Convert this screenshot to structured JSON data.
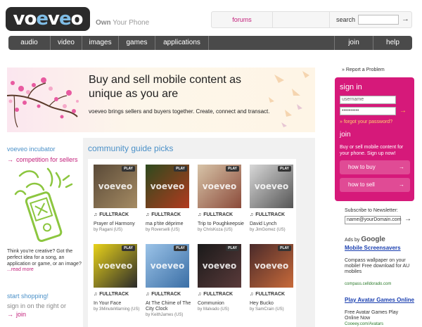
{
  "header": {
    "logo_text": "voeveo",
    "tagline_own": "Own",
    "tagline_rest": " Your Phone",
    "forums": "forums",
    "search_label": "search",
    "search_go": "→"
  },
  "nav": {
    "items": [
      "audio",
      "video",
      "images",
      "games",
      "applications"
    ],
    "join": "join",
    "help": "help"
  },
  "hero": {
    "headline": "Buy and sell mobile content as unique as you are",
    "body": "voeveo brings sellers and buyers together. Create, connect and transact."
  },
  "left": {
    "incubator_title": "voeveo incubator",
    "incubator_link": "competition for sellers",
    "incubator_text": "Think you're creative? Got the perfect idea for a song, an application or game, or an image?",
    "read_more": "...read more",
    "shop_title": "start shopping!",
    "shop_text": "sign in on the right or",
    "shop_link": "join"
  },
  "picks": {
    "title": "community guide picks",
    "play_label": "PLAY",
    "watermark": "voeveo",
    "fulltrack_label": "FULLTRACK",
    "cards": [
      {
        "title": "Prayer of Harmony",
        "by": "by Ragani (US)",
        "colors": [
          "#5a4a38",
          "#a58b63"
        ]
      },
      {
        "title": "ma p'tite déprime",
        "by": "by Roverselli (US)",
        "colors": [
          "#2e4a1e",
          "#b23a1e"
        ]
      },
      {
        "title": "Trip to Poughkeepsie",
        "by": "by ChrisKoza (US)",
        "colors": [
          "#d7c4a8",
          "#8b4a3a"
        ]
      },
      {
        "title": "David Lynch",
        "by": "by JimGomez (US)",
        "colors": [
          "#d8d8d8",
          "#555555"
        ]
      },
      {
        "title": "In Your Face",
        "by": "by 3MinuteWarning (US)",
        "colors": [
          "#e8d21a",
          "#2a2a2a"
        ]
      },
      {
        "title": "At The Chime of The City Clock",
        "by": "by KeithJames (US)",
        "colors": [
          "#9bc3e8",
          "#3a6ea5"
        ]
      },
      {
        "title": "Communion",
        "by": "by Malvado (US)",
        "colors": [
          "#1a1a1a",
          "#5a3a3a"
        ]
      },
      {
        "title": "Hey Bucko",
        "by": "by SamCrain (US)",
        "colors": [
          "#4a2a2a",
          "#c86a3a"
        ]
      }
    ]
  },
  "sidebar": {
    "report": "» Report a Problem",
    "signin_title": "sign in",
    "username": "username",
    "password": "••••••••••",
    "forgot": "» forgot your password?",
    "join_title": "join",
    "join_text": "Buy or sell mobile content for your phone. Sign up now!",
    "how_to_buy": "how to buy",
    "how_to_sell": "how to sell",
    "newsletter_title": "Subscribe to Newsletter:",
    "newsletter_value": "name@yourDomain.com",
    "ads_by": "Ads by",
    "google": "Google",
    "ad1_title": "Mobile Screensavers",
    "ad1_text": "Compass wallpaper on your mobile! Free download for AU mobiles",
    "ad1_url": "compass.celldorado.com",
    "ad2_title": "Play Avatar Games Online",
    "ad2_text": "Free Avatar Games Play Online Now",
    "ad2_url": "Cooeey.com/Avatars"
  },
  "colors": {
    "brand_pink": "#d6197a",
    "link_blue": "#4a90c8",
    "nav_dark": "#4a4a4a"
  }
}
